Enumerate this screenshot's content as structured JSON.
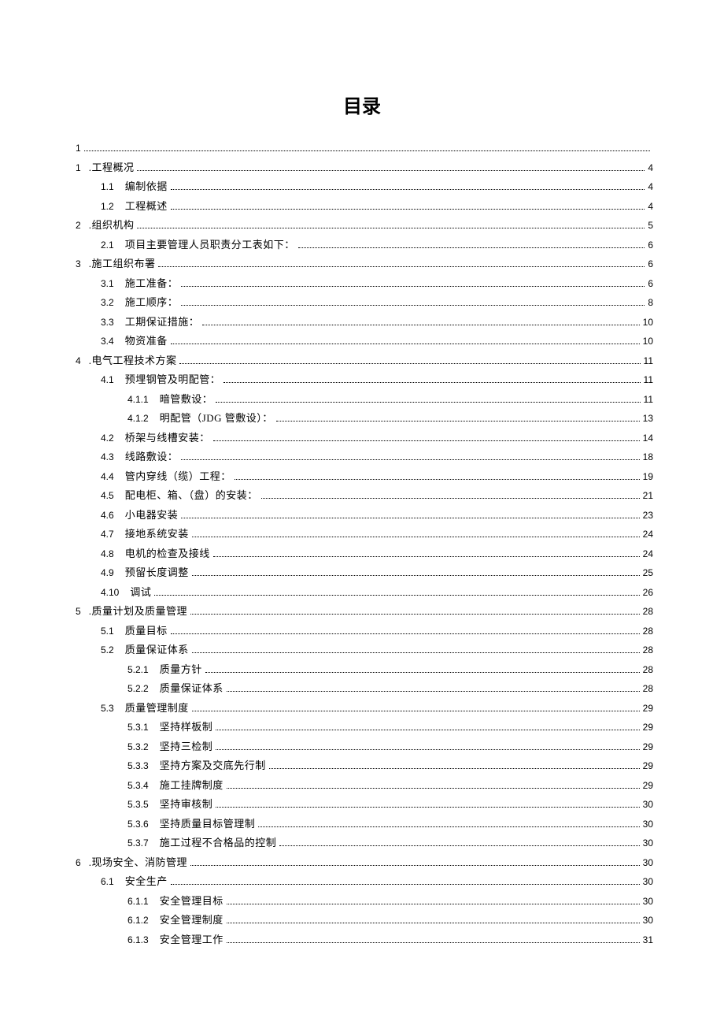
{
  "title": "目录",
  "entries": [
    {
      "level": 0,
      "num": "1",
      "label": "",
      "page": "",
      "nolabel": true
    },
    {
      "level": 0,
      "num": "1",
      "label": ".工程概况",
      "page": "4"
    },
    {
      "level": 1,
      "num": "1.1",
      "label": "编制依据",
      "page": "4"
    },
    {
      "level": 1,
      "num": "1.2",
      "label": "工程概述",
      "page": "4"
    },
    {
      "level": 0,
      "num": "2",
      "label": ".组织机构",
      "page": "5"
    },
    {
      "level": 1,
      "num": "2.1",
      "label": "项目主要管理人员职责分工表如下：",
      "page": "6"
    },
    {
      "level": 0,
      "num": "3",
      "label": ".施工组织布署",
      "page": "6"
    },
    {
      "level": 1,
      "num": "3.1",
      "label": "施工准备：",
      "page": "6"
    },
    {
      "level": 1,
      "num": "3.2",
      "label": "施工顺序：",
      "page": "8"
    },
    {
      "level": 1,
      "num": "3.3",
      "label": "工期保证措施：",
      "page": "10"
    },
    {
      "level": 1,
      "num": "3.4",
      "label": "物资准备",
      "page": "10"
    },
    {
      "level": 0,
      "num": "4",
      "label": ".电气工程技术方案",
      "page": "11"
    },
    {
      "level": 1,
      "num": "4.1",
      "label": "预埋钢管及明配管：",
      "page": "11"
    },
    {
      "level": 2,
      "num": "4.1.1",
      "label": "暗管敷设：",
      "page": "11"
    },
    {
      "level": 2,
      "num": "4.1.2",
      "label": "明配管（JDG 管敷设）：",
      "page": "13"
    },
    {
      "level": 1,
      "num": "4.2",
      "label": "桥架与线槽安装：",
      "page": "14"
    },
    {
      "level": 1,
      "num": "4.3",
      "label": "线路敷设：",
      "page": "18"
    },
    {
      "level": 1,
      "num": "4.4",
      "label": "管内穿线（缆）工程：",
      "page": "19"
    },
    {
      "level": 1,
      "num": "4.5",
      "label": "配电柜、箱、（盘）的安装：",
      "page": "21"
    },
    {
      "level": 1,
      "num": "4.6",
      "label": "小电器安装",
      "page": "23"
    },
    {
      "level": 1,
      "num": "4.7",
      "label": "接地系统安装",
      "page": "24"
    },
    {
      "level": 1,
      "num": "4.8",
      "label": "电机的检查及接线",
      "page": "24"
    },
    {
      "level": 1,
      "num": "4.9",
      "label": "预留长度调整",
      "page": "25"
    },
    {
      "level": 1,
      "num": "4.10",
      "label": "调试",
      "page": "26"
    },
    {
      "level": 0,
      "num": "5",
      "label": ".质量计划及质量管理",
      "page": "28"
    },
    {
      "level": 1,
      "num": "5.1",
      "label": "质量目标",
      "page": "28"
    },
    {
      "level": 1,
      "num": "5.2",
      "label": "质量保证体系",
      "page": "28"
    },
    {
      "level": 2,
      "num": "5.2.1",
      "label": "质量方针",
      "page": "28"
    },
    {
      "level": 2,
      "num": "5.2.2",
      "label": "质量保证体系",
      "page": "28"
    },
    {
      "level": 1,
      "num": "5.3",
      "label": "质量管理制度",
      "page": "29"
    },
    {
      "level": 2,
      "num": "5.3.1",
      "label": "坚持样板制",
      "page": "29"
    },
    {
      "level": 2,
      "num": "5.3.2",
      "label": "坚持三检制",
      "page": "29"
    },
    {
      "level": 2,
      "num": "5.3.3",
      "label": "坚持方案及交底先行制",
      "page": "29"
    },
    {
      "level": 2,
      "num": "5.3.4",
      "label": "施工挂牌制度",
      "page": "29"
    },
    {
      "level": 2,
      "num": "5.3.5",
      "label": "坚持审核制",
      "page": "30"
    },
    {
      "level": 2,
      "num": "5.3.6",
      "label": "坚持质量目标管理制",
      "page": "30"
    },
    {
      "level": 2,
      "num": "5.3.7",
      "label": "施工过程不合格品的控制",
      "page": "30"
    },
    {
      "level": 0,
      "num": "6",
      "label": ".现场安全、消防管理",
      "page": "30"
    },
    {
      "level": 1,
      "num": "6.1",
      "label": "安全生产",
      "page": "30"
    },
    {
      "level": 2,
      "num": "6.1.1",
      "label": "安全管理目标",
      "page": "30"
    },
    {
      "level": 2,
      "num": "6.1.2",
      "label": "安全管理制度",
      "page": "30"
    },
    {
      "level": 2,
      "num": "6.1.3",
      "label": "安全管理工作",
      "page": "31"
    }
  ]
}
